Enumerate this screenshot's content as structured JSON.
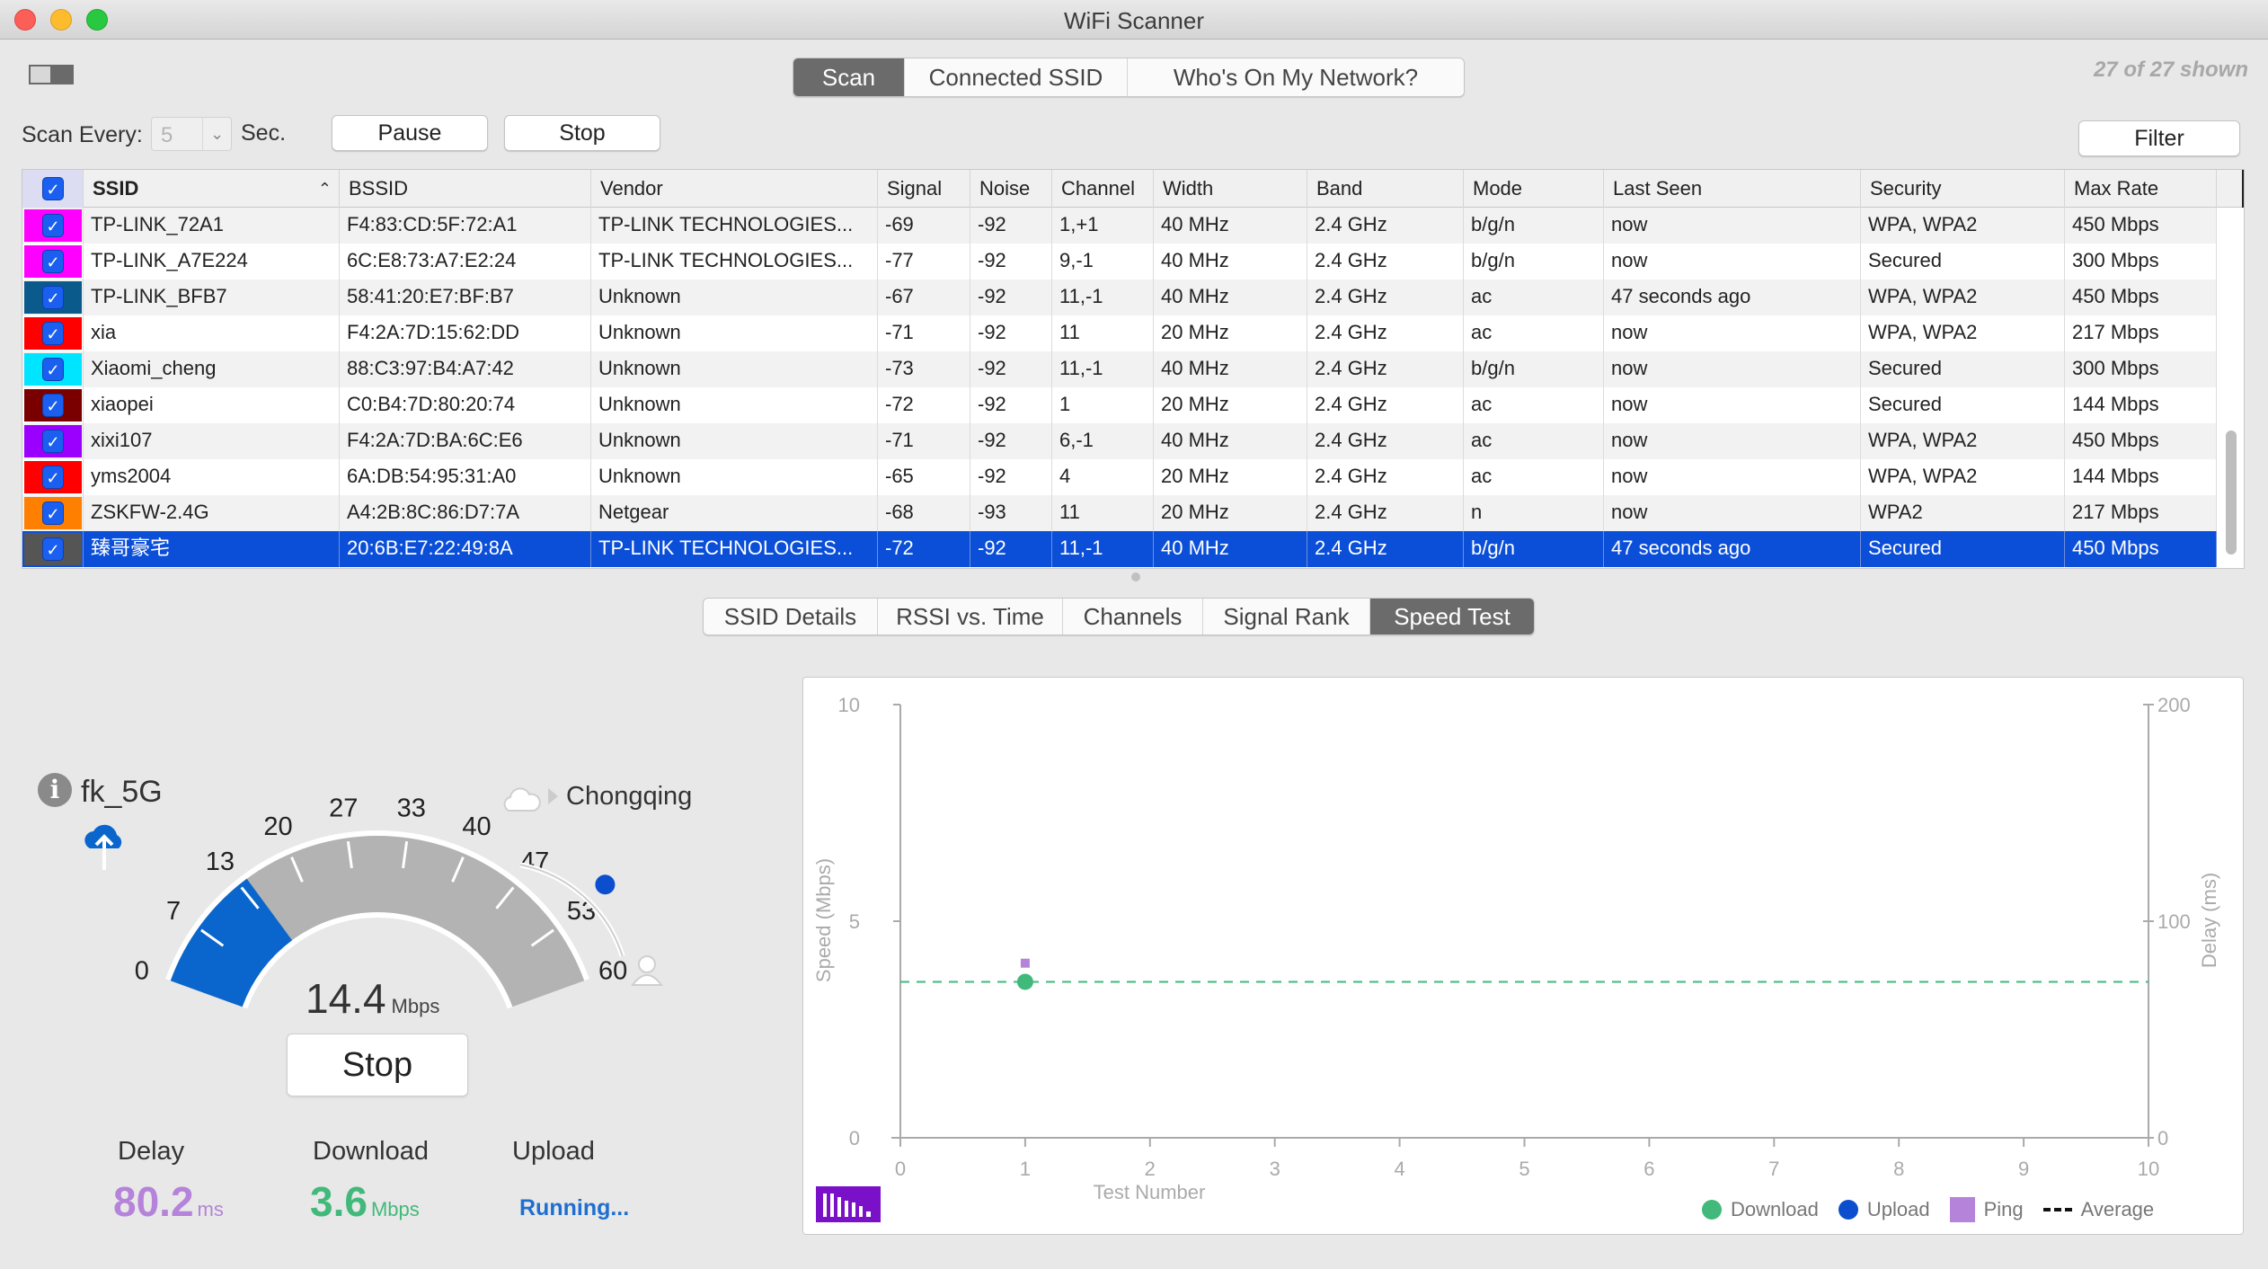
{
  "window": {
    "title": "WiFi Scanner"
  },
  "top_tabs": [
    {
      "label": "Scan",
      "active": true
    },
    {
      "label": "Connected SSID",
      "active": false
    },
    {
      "label": "Who's On My Network?",
      "active": false
    }
  ],
  "shown_count": "27 of 27 shown",
  "toolbar": {
    "scan_every_label": "Scan Every:",
    "interval_value": "5",
    "sec_label": "Sec.",
    "pause_label": "Pause",
    "stop_label": "Stop",
    "filter_label": "Filter"
  },
  "table": {
    "columns": [
      "SSID",
      "BSSID",
      "Vendor",
      "Signal",
      "Noise",
      "Channel",
      "Width",
      "Band",
      "Mode",
      "Last Seen",
      "Security",
      "Max Rate"
    ],
    "sort_column": "SSID",
    "sort_direction": "ascending",
    "rows": [
      {
        "color": "#ff00ff",
        "checked": true,
        "ssid": "TP-LINK_72A1",
        "bssid": "F4:83:CD:5F:72:A1",
        "vendor": "TP-LINK TECHNOLOGIES...",
        "signal": "-69",
        "noise": "-92",
        "channel": "1,+1",
        "width": "40 MHz",
        "band": "2.4 GHz",
        "mode": "b/g/n",
        "last_seen": "now",
        "security": "WPA, WPA2",
        "max_rate": "450 Mbps"
      },
      {
        "color": "#ff00ff",
        "checked": true,
        "ssid": "TP-LINK_A7E224",
        "bssid": "6C:E8:73:A7:E2:24",
        "vendor": "TP-LINK TECHNOLOGIES...",
        "signal": "-77",
        "noise": "-92",
        "channel": "9,-1",
        "width": "40 MHz",
        "band": "2.4 GHz",
        "mode": "b/g/n",
        "last_seen": "now",
        "security": "Secured",
        "max_rate": "300 Mbps"
      },
      {
        "color": "#0a5a8c",
        "checked": true,
        "ssid": "TP-LINK_BFB7",
        "bssid": "58:41:20:E7:BF:B7",
        "vendor": "Unknown",
        "signal": "-67",
        "noise": "-92",
        "channel": "11,-1",
        "width": "40 MHz",
        "band": "2.4 GHz",
        "mode": "ac",
        "last_seen": "47 seconds ago",
        "security": "WPA, WPA2",
        "max_rate": "450 Mbps"
      },
      {
        "color": "#ff0000",
        "checked": true,
        "ssid": "xia",
        "bssid": "F4:2A:7D:15:62:DD",
        "vendor": "Unknown",
        "signal": "-71",
        "noise": "-92",
        "channel": "11",
        "width": "20 MHz",
        "band": "2.4 GHz",
        "mode": "ac",
        "last_seen": "now",
        "security": "WPA, WPA2",
        "max_rate": "217 Mbps"
      },
      {
        "color": "#00e5ff",
        "checked": true,
        "ssid": "Xiaomi_cheng",
        "bssid": "88:C3:97:B4:A7:42",
        "vendor": "Unknown",
        "signal": "-73",
        "noise": "-92",
        "channel": "11,-1",
        "width": "40 MHz",
        "band": "2.4 GHz",
        "mode": "b/g/n",
        "last_seen": "now",
        "security": "Secured",
        "max_rate": "300 Mbps"
      },
      {
        "color": "#7a0000",
        "checked": true,
        "ssid": "xiaopei",
        "bssid": "C0:B4:7D:80:20:74",
        "vendor": "Unknown",
        "signal": "-72",
        "noise": "-92",
        "channel": "1",
        "width": "20 MHz",
        "band": "2.4 GHz",
        "mode": "ac",
        "last_seen": "now",
        "security": "Secured",
        "max_rate": "144 Mbps"
      },
      {
        "color": "#9b00ff",
        "checked": true,
        "ssid": "xixi107",
        "bssid": "F4:2A:7D:BA:6C:E6",
        "vendor": "Unknown",
        "signal": "-71",
        "noise": "-92",
        "channel": "6,-1",
        "width": "40 MHz",
        "band": "2.4 GHz",
        "mode": "ac",
        "last_seen": "now",
        "security": "WPA, WPA2",
        "max_rate": "450 Mbps"
      },
      {
        "color": "#ff0000",
        "checked": true,
        "ssid": "yms2004",
        "bssid": "6A:DB:54:95:31:A0",
        "vendor": "Unknown",
        "signal": "-65",
        "noise": "-92",
        "channel": "4",
        "width": "20 MHz",
        "band": "2.4 GHz",
        "mode": "ac",
        "last_seen": "now",
        "security": "WPA, WPA2",
        "max_rate": "144 Mbps"
      },
      {
        "color": "#ff7f00",
        "checked": true,
        "ssid": "ZSKFW-2.4G",
        "bssid": "A4:2B:8C:86:D7:7A",
        "vendor": "Netgear",
        "signal": "-68",
        "noise": "-93",
        "channel": "11",
        "width": "20 MHz",
        "band": "2.4 GHz",
        "mode": "n",
        "last_seen": "now",
        "security": "WPA2",
        "max_rate": "217 Mbps"
      },
      {
        "color": "#555555",
        "checked": true,
        "selected": true,
        "ssid": "臻哥豪宅",
        "bssid": "20:6B:E7:22:49:8A",
        "vendor": "TP-LINK TECHNOLOGIES...",
        "signal": "-72",
        "noise": "-92",
        "channel": "11,-1",
        "width": "40 MHz",
        "band": "2.4 GHz",
        "mode": "b/g/n",
        "last_seen": "47 seconds ago",
        "security": "Secured",
        "max_rate": "450 Mbps"
      }
    ]
  },
  "detail_tabs": [
    {
      "label": "SSID Details",
      "active": false
    },
    {
      "label": "RSSI vs. Time",
      "active": false
    },
    {
      "label": "Channels",
      "active": false
    },
    {
      "label": "Signal Rank",
      "active": false
    },
    {
      "label": "Speed Test",
      "active": true
    }
  ],
  "speed_test": {
    "network_name": "fk_5G",
    "server_name": "Chongqing",
    "gauge": {
      "value": 14.4,
      "value_text": "14.4",
      "unit": "Mbps",
      "min": 0,
      "max": 60,
      "ticks": [
        "0",
        "7",
        "13",
        "20",
        "27",
        "33",
        "40",
        "47",
        "53",
        "60"
      ]
    },
    "latency_slider_fraction": 0.55,
    "stop_label": "Stop",
    "delay": {
      "label": "Delay",
      "value": "80.2",
      "unit": "ms"
    },
    "download": {
      "label": "Download",
      "value": "3.6",
      "unit": "Mbps"
    },
    "upload": {
      "label": "Upload",
      "status": "Running..."
    },
    "colors": {
      "gauge_fill": "#0a66cc",
      "gauge_track": "#b3b3b3",
      "delay": "#b583d9",
      "download": "#41b97a",
      "upload": "#1f6fd0"
    }
  },
  "chart_data": {
    "type": "scatter",
    "title": "",
    "xlabel": "Test Number",
    "ylabel": "Speed (Mbps)",
    "y2label": "Delay (ms)",
    "xlim": [
      0,
      10
    ],
    "ylim": [
      0,
      10
    ],
    "y2lim": [
      0,
      200
    ],
    "x_ticks": [
      "0",
      "1",
      "2",
      "3",
      "4",
      "5",
      "6",
      "7",
      "8",
      "9",
      "10"
    ],
    "y_ticks": [
      "0",
      "5",
      "10"
    ],
    "y2_ticks": [
      "0",
      "100",
      "200"
    ],
    "grid": false,
    "legend_position": "bottom-right",
    "series": [
      {
        "name": "Download",
        "marker": "circle",
        "color": "#41b97a",
        "axis": "left",
        "points": [
          {
            "x": 1,
            "y": 3.6
          }
        ]
      },
      {
        "name": "Upload",
        "marker": "circle",
        "color": "#0b4fcf",
        "axis": "left",
        "points": []
      },
      {
        "name": "Ping",
        "marker": "square",
        "color": "#b583d9",
        "axis": "right",
        "points": [
          {
            "x": 1,
            "y": 80.2
          }
        ]
      },
      {
        "name": "Average",
        "marker": "dash",
        "color": "#41b97a",
        "axis": "left",
        "value": 3.6
      }
    ]
  }
}
